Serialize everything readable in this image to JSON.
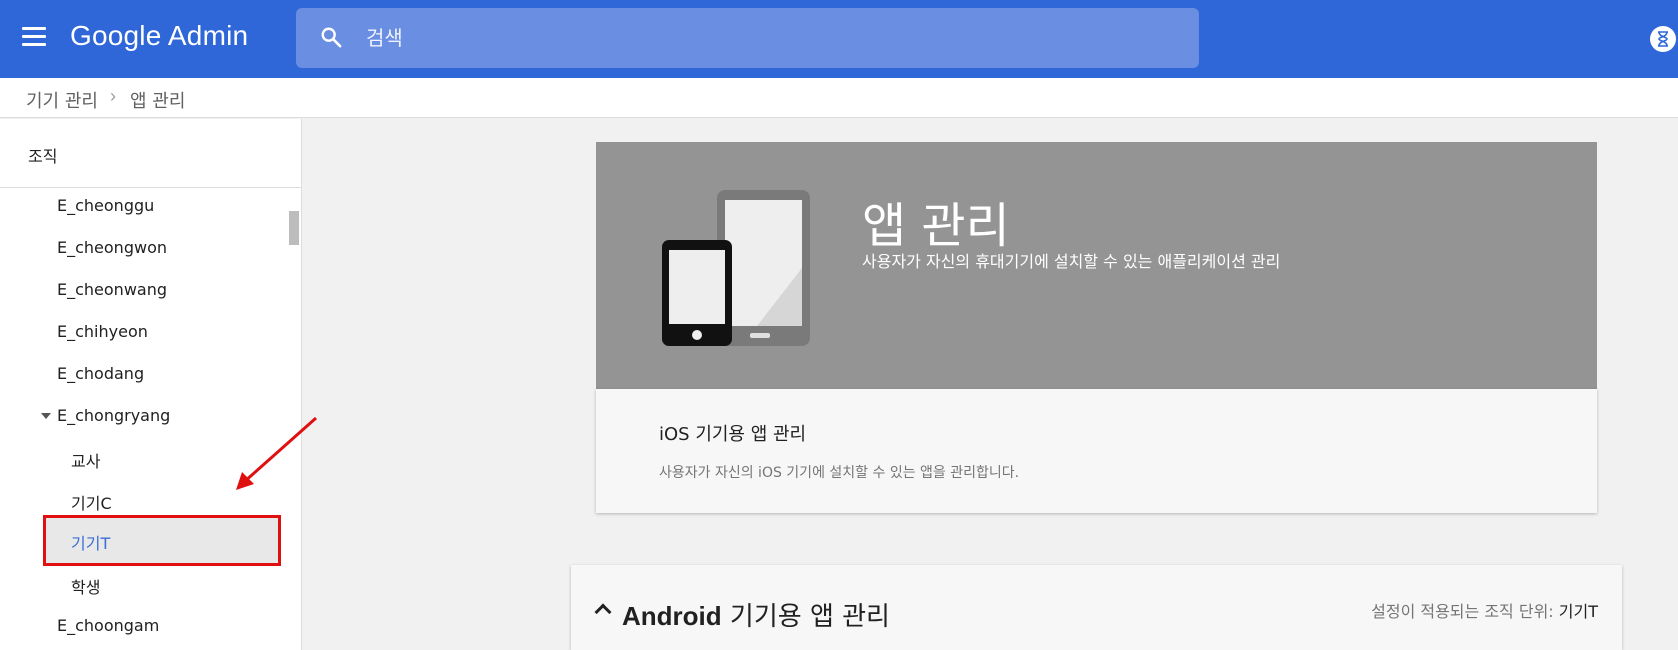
{
  "header": {
    "app_name": "Google Admin",
    "search_placeholder": "검색"
  },
  "breadcrumb": {
    "items": [
      "기기 관리",
      "앱 관리"
    ],
    "separator": "›"
  },
  "sidebar": {
    "title": "조직",
    "items": [
      {
        "label": "E_cheonggu",
        "level": 0
      },
      {
        "label": "E_cheongwon",
        "level": 0
      },
      {
        "label": "E_cheonwang",
        "level": 0
      },
      {
        "label": "E_chihyeon",
        "level": 0
      },
      {
        "label": "E_chodang",
        "level": 0
      },
      {
        "label": "E_chongryang",
        "level": 0,
        "expanded": true
      },
      {
        "label": "교사",
        "level": 1
      },
      {
        "label": "기기C",
        "level": 1
      },
      {
        "label": "기기T",
        "level": 1,
        "selected": true
      },
      {
        "label": "학생",
        "level": 1
      },
      {
        "label": "E_choongam",
        "level": 0
      }
    ]
  },
  "hero": {
    "title": "앱 관리",
    "subtitle": "사용자가 자신의 휴대기기에 설치할 수 있는 애플리케이션 관리"
  },
  "ios_card": {
    "title": "iOS 기기용 앱 관리",
    "description": "사용자가 자신의 iOS 기기에 설치할 수 있는 앱을 관리합니다."
  },
  "android_card": {
    "title_bold": "Android",
    "title_rest": " 기기용 앱 관리",
    "org_unit_label": "설정이 적용되는 조직 단위: ",
    "org_unit_value": "기기T"
  },
  "colors": {
    "topbar": "#2f67d8",
    "selected_text": "#3b6ed6",
    "annotation_red": "#e01010",
    "hero_bg": "#949494"
  }
}
